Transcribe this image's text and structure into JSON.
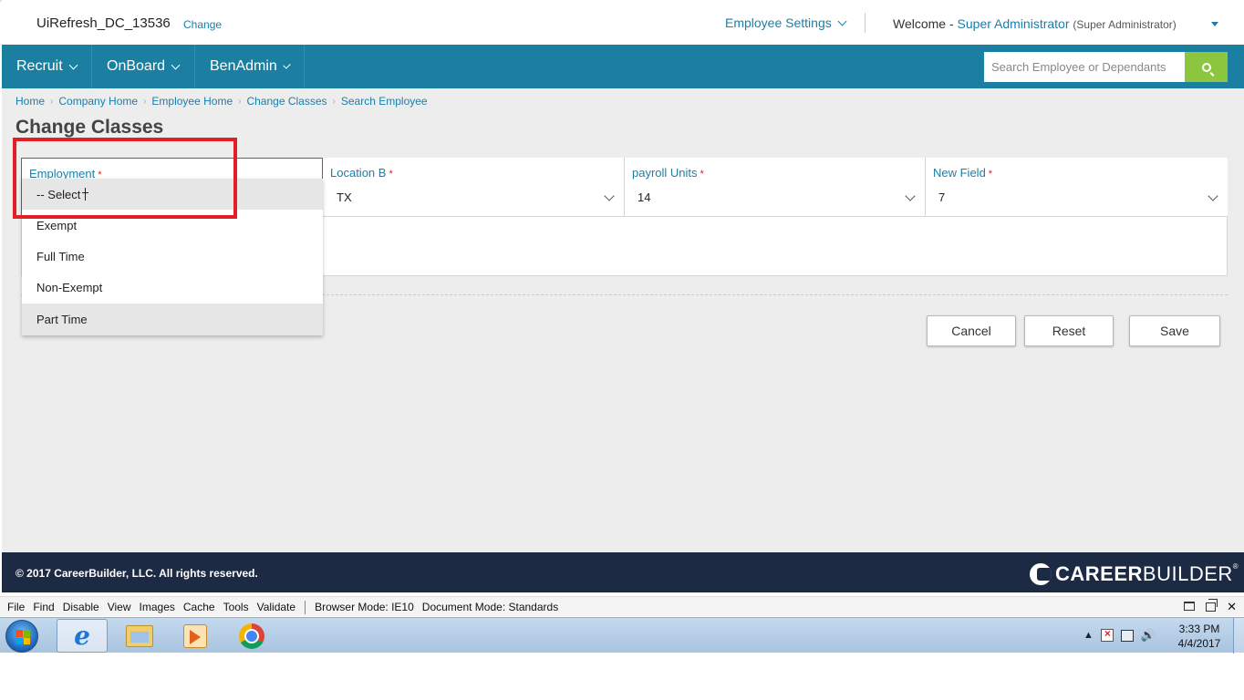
{
  "header": {
    "site_name": "UiRefresh_DC_13536",
    "change_link": "Change",
    "employee_settings": "Employee Settings",
    "welcome_prefix": "Welcome -",
    "user_name": "Super Administrator",
    "user_role": "(Super Administrator)"
  },
  "nav": {
    "items": [
      {
        "label": "Recruit"
      },
      {
        "label": "OnBoard"
      },
      {
        "label": "BenAdmin"
      }
    ],
    "search_placeholder": "Search Employee or Dependants"
  },
  "breadcrumb": [
    "Home",
    "Company Home",
    "Employee Home",
    "Change Classes",
    "Search Employee"
  ],
  "page_title": "Change Classes",
  "form": {
    "fields": [
      {
        "label": "Employment",
        "value": "-- Select --",
        "required": true
      },
      {
        "label": "Location B",
        "value": "TX",
        "required": true
      },
      {
        "label": "payroll Units",
        "value": "14",
        "required": true
      },
      {
        "label": "New Field",
        "value": "7",
        "required": true
      }
    ],
    "required_marker": "*"
  },
  "dropdown": {
    "options": [
      "-- Select",
      "Exempt",
      "Full Time",
      "Non-Exempt",
      "Part Time"
    ],
    "highlighted": [
      "-- Select",
      "Part Time"
    ]
  },
  "buttons": {
    "cancel": "Cancel",
    "reset": "Reset",
    "save": "Save"
  },
  "footer": {
    "copyright": "© 2017 CareerBuilder, LLC. All rights reserved.",
    "logo_career": "CAREER",
    "logo_builder": "BUILDER",
    "logo_tm": "®"
  },
  "devbar": {
    "menu": [
      "File",
      "Find",
      "Disable",
      "View",
      "Images",
      "Cache",
      "Tools",
      "Validate"
    ],
    "browser_mode": "Browser Mode: IE10",
    "document_mode": "Document Mode: Standards"
  },
  "taskbar": {
    "time": "3:33 PM",
    "date": "4/4/2017",
    "tray_arrow": "▲",
    "volume": "🔊"
  },
  "colors": {
    "nav_bg": "#1a7fa0",
    "link": "#1a7fa8",
    "search_button": "#8cc63f",
    "footer_bg": "#1d2a44",
    "highlight_box": "#e31e24"
  },
  "icons": [
    "chevron-down-icon",
    "search-icon",
    "start-orb-icon",
    "internet-explorer-icon",
    "file-explorer-icon",
    "media-player-icon",
    "chrome-icon"
  ]
}
